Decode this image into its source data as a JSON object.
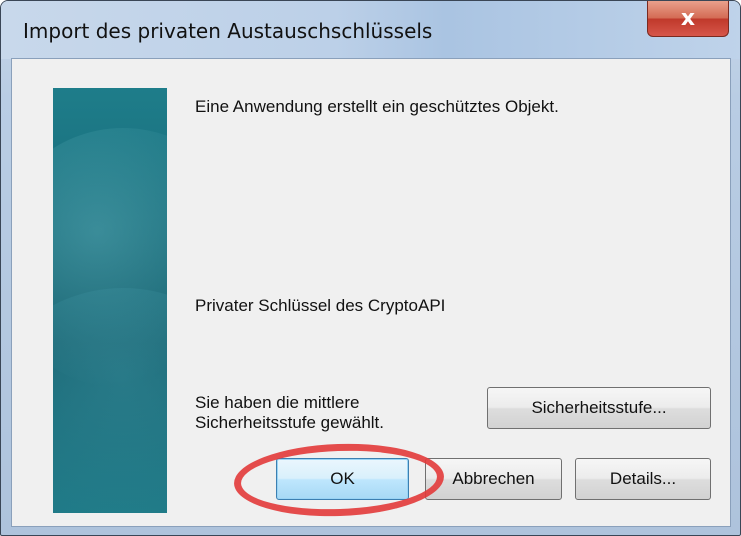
{
  "window": {
    "title": "Import des privaten Austauschschlüssels",
    "close_label": "x"
  },
  "dialog": {
    "message_main": "Eine Anwendung erstellt ein geschütztes Objekt.",
    "message_key": "Privater Schlüssel des CryptoAPI",
    "message_level": "Sie haben die mittlere Sicherheitsstufe gewählt."
  },
  "buttons": {
    "security_level": "Sicherheitsstufe...",
    "ok": "OK",
    "cancel": "Abbrechen",
    "details": "Details..."
  },
  "annotation": {
    "highlight_color": "#e23a3a",
    "highlight_target": "ok-button"
  },
  "colors": {
    "side_panel": "#1a6e7c",
    "close_button": "#c0392b",
    "ok_button_border": "#3c7fb1"
  }
}
